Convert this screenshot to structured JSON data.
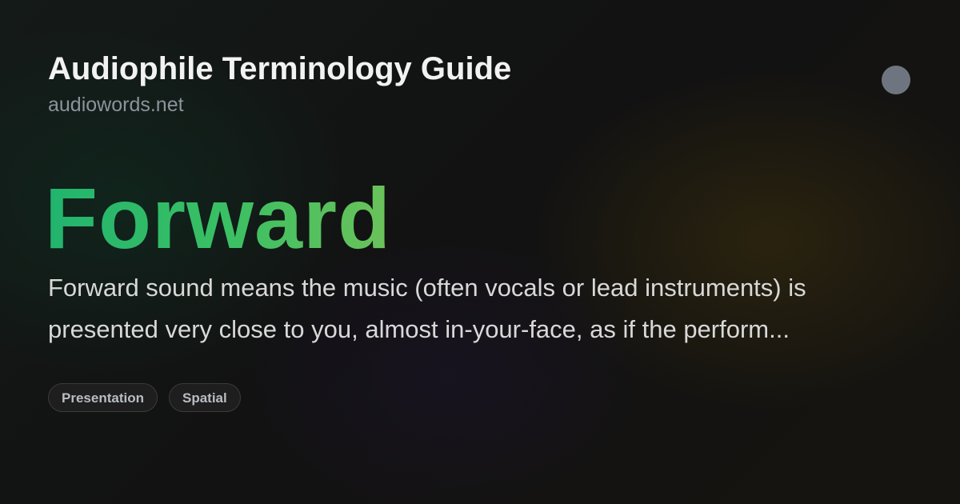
{
  "header": {
    "title": "Audiophile Terminology Guide",
    "domain": "audiowords.net"
  },
  "term": {
    "word": "Forward",
    "definition": "Forward sound means the music (often vocals or lead instruments) is presented very close to you, almost in-your-face, as if the perform..."
  },
  "tags": [
    "Presentation",
    "Spatial"
  ],
  "colors": {
    "accent_gradient_start": "#21b46e",
    "accent_gradient_end": "#6cc25a",
    "avatar_dot": "#6f7580"
  }
}
